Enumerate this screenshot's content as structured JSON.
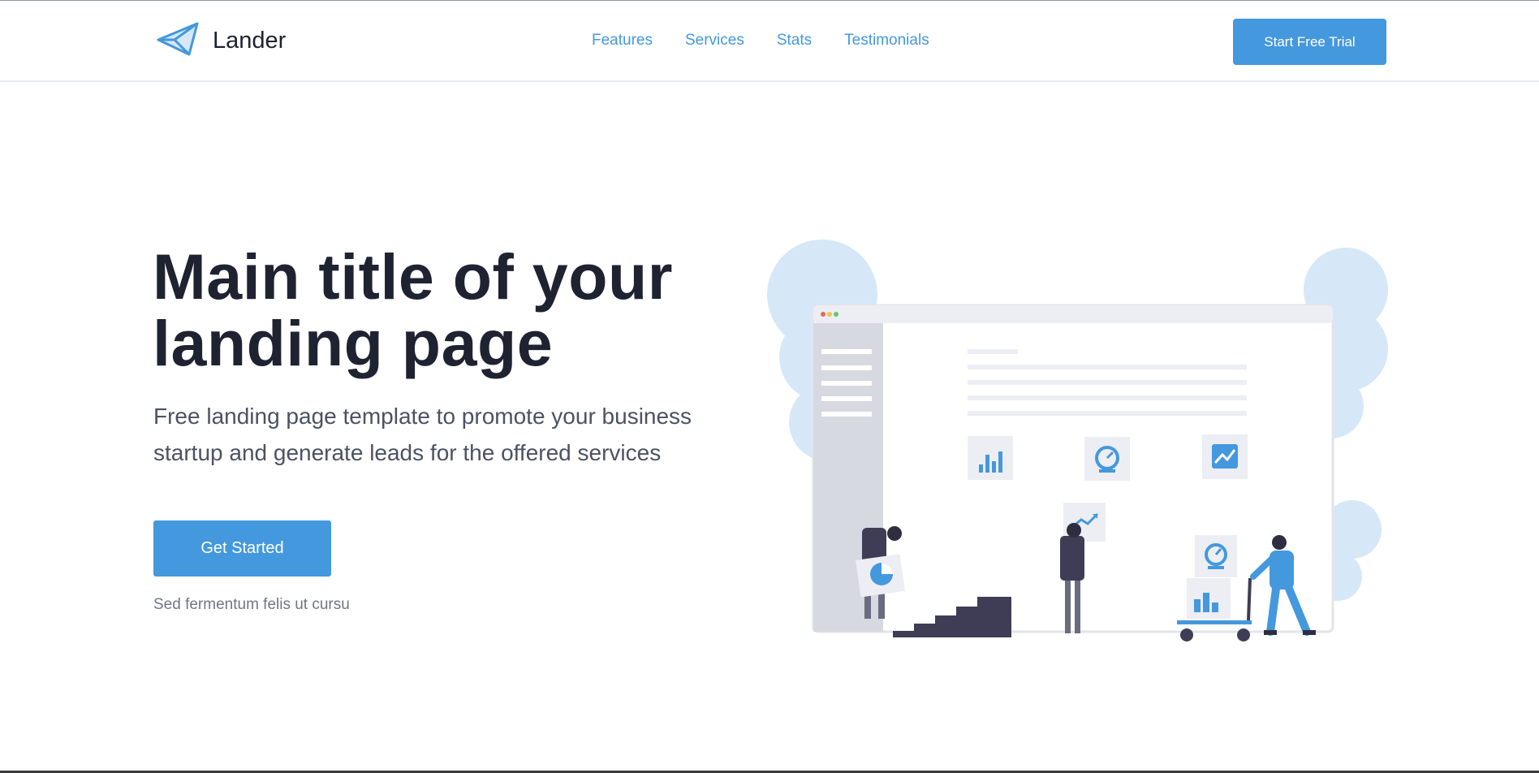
{
  "brand": {
    "name": "Lander",
    "logo_icon": "paper-plane-icon"
  },
  "nav": {
    "links": [
      {
        "label": "Features"
      },
      {
        "label": "Services"
      },
      {
        "label": "Stats"
      },
      {
        "label": "Testimonials"
      }
    ],
    "cta_label": "Start Free Trial"
  },
  "hero": {
    "title_line1": "Main title of your",
    "title_line2": "landing page",
    "subtitle_line1": "Free landing page template to promote your business",
    "subtitle_line2": "startup and generate leads for the offered services",
    "button_label": "Get Started",
    "note": "Sed fermentum felis ut cursu"
  },
  "illustration": {
    "icons": [
      "bar-chart-icon",
      "speedometer-icon",
      "line-chart-icon",
      "pie-chart-icon",
      "trend-up-icon"
    ]
  },
  "colors": {
    "accent": "#4498dd",
    "heading": "#1f2331",
    "body_text": "#4b5263",
    "muted": "#6f7687"
  }
}
